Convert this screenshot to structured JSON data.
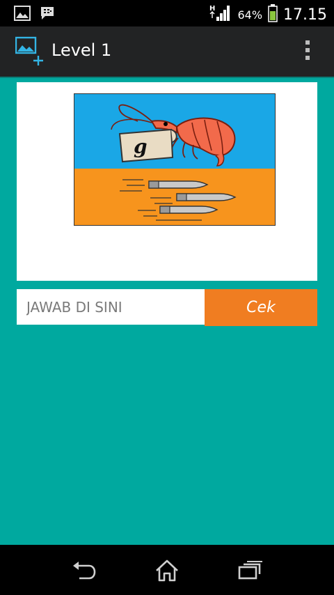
{
  "status_bar": {
    "battery_percent": "64%",
    "time": "17.15",
    "network_type": "H"
  },
  "action_bar": {
    "title": "Level 1"
  },
  "answer": {
    "placeholder": "JAWAB DI SINI",
    "value": "",
    "check_label": "Cek"
  },
  "puzzle": {
    "letter": "g"
  },
  "colors": {
    "background": "#00a99f",
    "action_bar": "#222324",
    "check_button": "#f07d21",
    "puzzle_sky": "#1aa7e6",
    "puzzle_ground": "#f7941d"
  }
}
